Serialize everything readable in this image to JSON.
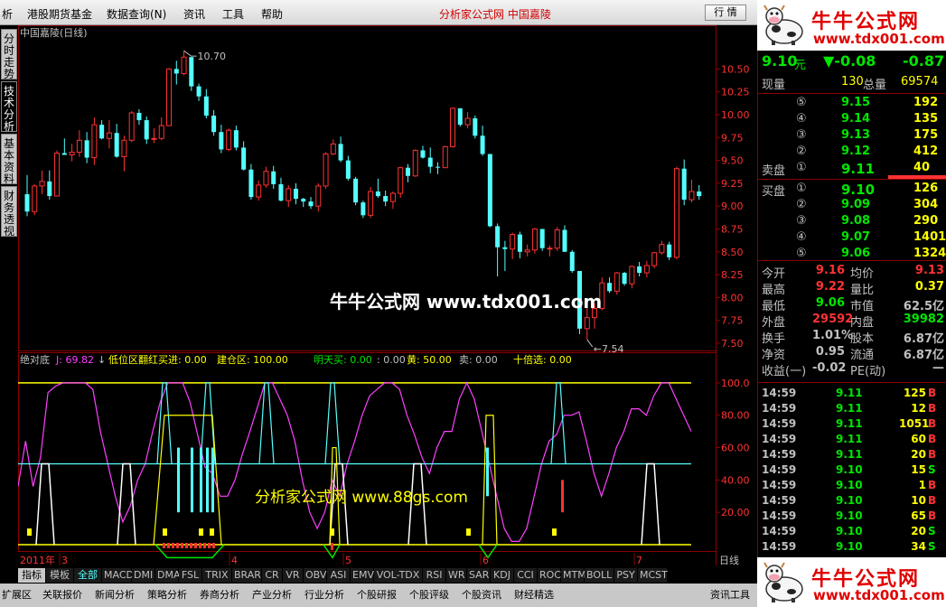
{
  "menu": {
    "items": [
      "析",
      "港股期货基金",
      "数据查询(N)",
      "资讯",
      "工具",
      "帮助"
    ],
    "title": "分析家公式网  中国嘉陵",
    "btn_quote": "行 情",
    "btn_min": "_",
    "btn_restore": "□",
    "btn_close": "×"
  },
  "logo": {
    "text": "牛牛公式网",
    "url": "www.tdx001.com"
  },
  "left_tabs": [
    "分时走势",
    "技术分析",
    "基本资料",
    "财务透视"
  ],
  "chart": {
    "title": "中国嘉陵(日线)",
    "watermark": "牛牛公式网 www.tdx001.com",
    "watermark2": "分析家公式网 www.88gs.com",
    "high_label": "10.70",
    "low_label": "7.54",
    "indicator_legend": {
      "name": "绝对底",
      "j": "J: 69.82",
      "l1": "低位区翻红买进: 0.00",
      "l2": "建仓区: 100.00",
      "l3": "明天买: 0.00",
      "l4": ": 0.00",
      "l5": "黄: 50.00",
      "l6": "卖: 0.00",
      "l7": "十倍选: 0.00"
    },
    "x_labels": [
      "2011年",
      "3",
      "4",
      "5",
      "6",
      "7"
    ],
    "period": "日线",
    "colors": {
      "up": "#ff3232",
      "down": "#54ffff",
      "ma": "#ffffff"
    }
  },
  "chart_data": [
    {
      "type": "candlestick",
      "title": "中国嘉陵(日线)",
      "ylim": [
        7.5,
        10.8
      ],
      "y_ticks": [
        "10.50",
        "10.25",
        "10.00",
        "9.75",
        "9.50",
        "9.25",
        "9.00",
        "8.75",
        "8.50",
        "8.25",
        "8.00",
        "7.75",
        "7.50"
      ],
      "ohlc": [
        [
          9.13,
          9.34,
          8.89,
          8.94
        ],
        [
          8.94,
          9.24,
          8.9,
          9.22
        ],
        [
          9.22,
          9.39,
          9.13,
          9.27
        ],
        [
          9.27,
          9.39,
          9.07,
          9.11
        ],
        [
          9.11,
          9.61,
          9.11,
          9.58
        ],
        [
          9.58,
          9.74,
          9.56,
          9.56
        ],
        [
          9.56,
          9.68,
          9.49,
          9.59
        ],
        [
          9.59,
          9.83,
          9.54,
          9.72
        ],
        [
          9.72,
          9.81,
          9.47,
          9.53
        ],
        [
          9.53,
          9.97,
          9.45,
          9.89
        ],
        [
          9.89,
          9.94,
          9.73,
          9.74
        ],
        [
          9.74,
          9.94,
          9.63,
          9.8
        ],
        [
          9.8,
          9.9,
          9.53,
          9.54
        ],
        [
          9.54,
          9.77,
          9.38,
          9.72
        ],
        [
          9.72,
          10.04,
          9.7,
          10.02
        ],
        [
          10.02,
          10.06,
          9.89,
          9.94
        ],
        [
          9.94,
          9.98,
          9.68,
          9.73
        ],
        [
          9.73,
          9.85,
          9.69,
          9.74
        ],
        [
          9.74,
          9.97,
          9.72,
          9.88
        ],
        [
          9.88,
          10.51,
          9.88,
          10.5
        ],
        [
          10.5,
          10.59,
          10.33,
          10.45
        ],
        [
          10.45,
          10.7,
          10.43,
          10.63
        ],
        [
          10.63,
          10.63,
          10.26,
          10.31
        ],
        [
          10.31,
          10.34,
          10.15,
          10.2
        ],
        [
          10.2,
          10.28,
          9.96,
          9.99
        ],
        [
          9.99,
          10.05,
          9.77,
          9.81
        ],
        [
          9.81,
          9.89,
          9.58,
          9.62
        ],
        [
          9.62,
          9.85,
          9.6,
          9.83
        ],
        [
          9.83,
          9.88,
          9.61,
          9.64
        ],
        [
          9.64,
          9.71,
          9.39,
          9.4
        ],
        [
          9.4,
          9.46,
          9.07,
          9.1
        ],
        [
          9.1,
          9.28,
          9.06,
          9.23
        ],
        [
          9.23,
          9.43,
          9.2,
          9.38
        ],
        [
          9.38,
          9.44,
          9.19,
          9.24
        ],
        [
          9.24,
          9.31,
          9.05,
          9.06
        ],
        [
          9.06,
          9.23,
          8.99,
          9.19
        ],
        [
          9.19,
          9.25,
          9.02,
          9.08
        ],
        [
          9.08,
          9.09,
          8.99,
          9.05
        ],
        [
          9.05,
          9.1,
          8.97,
          9.0
        ],
        [
          9.0,
          9.25,
          8.94,
          9.22
        ],
        [
          9.22,
          9.59,
          9.19,
          9.57
        ],
        [
          9.57,
          9.73,
          9.56,
          9.68
        ],
        [
          9.68,
          9.76,
          9.48,
          9.5
        ],
        [
          9.5,
          9.55,
          9.28,
          9.3
        ],
        [
          9.3,
          9.32,
          9.01,
          9.04
        ],
        [
          9.04,
          9.06,
          8.87,
          8.9
        ],
        [
          8.9,
          9.21,
          8.87,
          9.16
        ],
        [
          9.16,
          9.3,
          9.09,
          9.11
        ],
        [
          9.11,
          9.17,
          9.0,
          9.05
        ],
        [
          9.05,
          9.16,
          8.97,
          9.14
        ],
        [
          9.14,
          9.43,
          9.09,
          9.42
        ],
        [
          9.42,
          9.46,
          9.26,
          9.33
        ],
        [
          9.33,
          9.62,
          9.32,
          9.61
        ],
        [
          9.61,
          9.66,
          9.52,
          9.53
        ],
        [
          9.53,
          9.64,
          9.36,
          9.43
        ],
        [
          9.43,
          9.48,
          9.35,
          9.42
        ],
        [
          9.42,
          9.66,
          9.42,
          9.65
        ],
        [
          9.65,
          10.08,
          9.64,
          10.07
        ],
        [
          10.07,
          10.07,
          9.87,
          9.89
        ],
        [
          9.89,
          10.03,
          9.85,
          9.96
        ],
        [
          9.96,
          9.99,
          9.74,
          9.77
        ],
        [
          9.77,
          9.88,
          9.55,
          9.57
        ],
        [
          9.57,
          9.57,
          8.77,
          8.78
        ],
        [
          8.78,
          8.81,
          8.23,
          8.55
        ],
        [
          8.55,
          8.62,
          8.29,
          8.53
        ],
        [
          8.53,
          8.71,
          8.42,
          8.69
        ],
        [
          8.69,
          8.72,
          8.43,
          8.5
        ],
        [
          8.5,
          8.58,
          8.45,
          8.52
        ],
        [
          8.52,
          8.76,
          8.48,
          8.75
        ],
        [
          8.75,
          8.75,
          8.51,
          8.54
        ],
        [
          8.54,
          8.57,
          8.45,
          8.54
        ],
        [
          8.54,
          8.77,
          8.51,
          8.74
        ],
        [
          8.74,
          8.79,
          8.5,
          8.5
        ],
        [
          8.5,
          8.52,
          8.27,
          8.29
        ],
        [
          8.29,
          8.29,
          7.6,
          7.66
        ],
        [
          7.66,
          7.94,
          7.54,
          7.78
        ],
        [
          7.78,
          7.94,
          7.66,
          7.88
        ],
        [
          7.88,
          8.22,
          7.86,
          8.16
        ],
        [
          8.16,
          8.22,
          8.05,
          8.07
        ],
        [
          8.07,
          8.28,
          8.03,
          8.27
        ],
        [
          8.27,
          8.28,
          8.13,
          8.15
        ],
        [
          8.15,
          8.35,
          8.1,
          8.34
        ],
        [
          8.34,
          8.39,
          8.23,
          8.27
        ],
        [
          8.27,
          8.4,
          8.22,
          8.35
        ],
        [
          8.35,
          8.5,
          8.32,
          8.49
        ],
        [
          8.49,
          8.62,
          8.47,
          8.58
        ],
        [
          8.58,
          8.61,
          8.41,
          8.44
        ],
        [
          8.44,
          9.43,
          8.42,
          9.41
        ],
        [
          9.41,
          9.51,
          9.01,
          9.07
        ],
        [
          9.07,
          9.29,
          9.04,
          9.16
        ],
        [
          9.16,
          9.23,
          9.07,
          9.11
        ]
      ]
    },
    {
      "type": "line",
      "title": "绝对底",
      "ylim": [
        0,
        110
      ],
      "y_ticks": [
        "100.0",
        "80.00",
        "60.00",
        "40.00",
        "20.00"
      ],
      "series": [
        {
          "name": "J",
          "values": [
            36,
            64,
            36,
            54,
            94,
            98,
            100,
            100,
            100,
            100,
            96,
            70,
            50,
            30,
            14,
            24,
            40,
            50,
            70,
            88,
            100,
            100,
            100,
            88,
            68,
            48,
            44,
            30,
            30,
            40,
            56,
            70,
            85,
            100,
            100,
            90,
            80,
            64,
            40,
            20,
            10,
            20,
            40,
            30,
            50,
            64,
            80,
            92,
            96,
            100,
            100,
            96,
            80,
            68,
            54,
            44,
            60,
            70,
            70,
            90,
            100,
            90,
            70,
            50,
            30,
            10,
            2,
            2,
            10,
            30,
            50,
            64,
            68,
            80,
            80,
            82,
            64,
            44,
            30,
            44,
            60,
            70,
            84,
            84,
            80,
            92,
            100,
            100,
            90,
            80,
            70
          ]
        },
        {
          "name": "黄",
          "values": [
            50,
            50,
            50,
            50,
            50,
            50,
            50,
            50,
            50,
            50,
            50,
            50,
            50,
            50,
            50,
            50,
            50,
            50,
            50,
            50,
            50,
            50,
            50,
            50,
            50,
            50,
            50,
            50,
            50,
            50,
            50,
            50,
            50,
            50,
            50,
            50,
            50,
            50,
            50,
            50,
            50,
            50,
            50,
            50,
            50,
            50,
            50,
            50,
            50,
            50,
            50,
            50,
            50,
            50,
            50,
            50,
            50,
            50,
            50,
            50,
            50,
            50,
            50,
            50,
            50,
            50,
            50,
            50,
            50,
            50,
            50,
            50,
            50,
            50,
            50,
            50,
            50,
            50,
            50,
            50,
            50,
            50,
            50,
            50,
            50,
            50,
            50,
            50,
            50,
            50,
            50
          ]
        }
      ]
    }
  ],
  "quote": {
    "price": "9.10",
    "price_unit": "元",
    "change": "▼-0.08",
    "change_pct": "-0.87",
    "vol_now_label": "现量",
    "vol_now": "130",
    "vol_total_label": "总量",
    "vol_total": "69574",
    "ask": [
      {
        "label": "⑤",
        "price": "9.15",
        "vol": "192"
      },
      {
        "label": "④",
        "price": "9.14",
        "vol": "135"
      },
      {
        "label": "③",
        "price": "9.13",
        "vol": "175"
      },
      {
        "label": "②",
        "price": "9.12",
        "vol": "412"
      },
      {
        "label": "①",
        "price": "9.11",
        "vol": "40"
      }
    ],
    "ask_title": "卖盘",
    "bid_title": "买盘",
    "bid": [
      {
        "label": "①",
        "price": "9.10",
        "vol": "126"
      },
      {
        "label": "②",
        "price": "9.09",
        "vol": "304"
      },
      {
        "label": "③",
        "price": "9.08",
        "vol": "290"
      },
      {
        "label": "④",
        "price": "9.07",
        "vol": "1401"
      },
      {
        "label": "⑤",
        "price": "9.06",
        "vol": "1324"
      }
    ],
    "stats": [
      [
        {
          "label": "今开",
          "value": "9.16",
          "color": "#ff3232"
        },
        {
          "label": "均价",
          "value": "9.13",
          "color": "#ff3232"
        }
      ],
      [
        {
          "label": "最高",
          "value": "9.22",
          "color": "#ff3232"
        },
        {
          "label": "量比",
          "value": "0.37",
          "color": "#ffff00"
        }
      ],
      [
        {
          "label": "最低",
          "value": "9.06",
          "color": "#00e600"
        },
        {
          "label": "市值",
          "value": "62.5亿",
          "color": "#c0c0c0"
        }
      ],
      [
        {
          "label": "外盘",
          "value": "29592",
          "color": "#ff3232"
        },
        {
          "label": "内盘",
          "value": "39982",
          "color": "#00e600"
        }
      ],
      [
        {
          "label": "换手",
          "value": "1.01%",
          "color": "#c0c0c0"
        },
        {
          "label": "股本",
          "value": "6.87亿",
          "color": "#c0c0c0"
        }
      ],
      [
        {
          "label": "净资",
          "value": "0.95",
          "color": "#c0c0c0"
        },
        {
          "label": "流通",
          "value": "6.87亿",
          "color": "#c0c0c0"
        }
      ],
      [
        {
          "label": "收益(一)",
          "value": "-0.02",
          "color": "#c0c0c0"
        },
        {
          "label": "PE(动)",
          "value": "—",
          "color": "#c0c0c0"
        }
      ]
    ],
    "ticks": [
      {
        "time": "14:59",
        "price": "9.11",
        "vol": "125",
        "bs": "B"
      },
      {
        "time": "14:59",
        "price": "9.11",
        "vol": "12",
        "bs": "B"
      },
      {
        "time": "14:59",
        "price": "9.11",
        "vol": "1051",
        "bs": "B"
      },
      {
        "time": "14:59",
        "price": "9.11",
        "vol": "60",
        "bs": "B"
      },
      {
        "time": "14:59",
        "price": "9.11",
        "vol": "20",
        "bs": "B"
      },
      {
        "time": "14:59",
        "price": "9.10",
        "vol": "15",
        "bs": "S"
      },
      {
        "time": "14:59",
        "price": "9.10",
        "vol": "1",
        "bs": "B"
      },
      {
        "time": "14:59",
        "price": "9.10",
        "vol": "10",
        "bs": "B"
      },
      {
        "time": "14:59",
        "price": "9.10",
        "vol": "65",
        "bs": "B"
      },
      {
        "time": "14:59",
        "price": "9.10",
        "vol": "20",
        "bs": "S"
      },
      {
        "time": "14:59",
        "price": "9.10",
        "vol": "34",
        "bs": "S"
      }
    ]
  },
  "indicator_tabs": [
    "指标",
    "模板",
    "全部",
    "MACD",
    "DMI",
    "DMA",
    "FSL",
    "TRIX",
    "BRAR",
    "CR",
    "VR",
    "OBV",
    "ASI",
    "EMV",
    "VOL-TDX",
    "RSI",
    "WR",
    "SAR",
    "KDJ",
    "CCI",
    "ROC",
    "MTM",
    "BOLL",
    "PSY",
    "MCST"
  ],
  "bottom_tabs": [
    "扩展区",
    "关联报价",
    "新闻分析",
    "策略分析",
    "券商分析",
    "产业分析",
    "行业分析",
    "个股研报",
    "个股评级",
    "个股资讯",
    "财经精选",
    "资讯工具"
  ]
}
